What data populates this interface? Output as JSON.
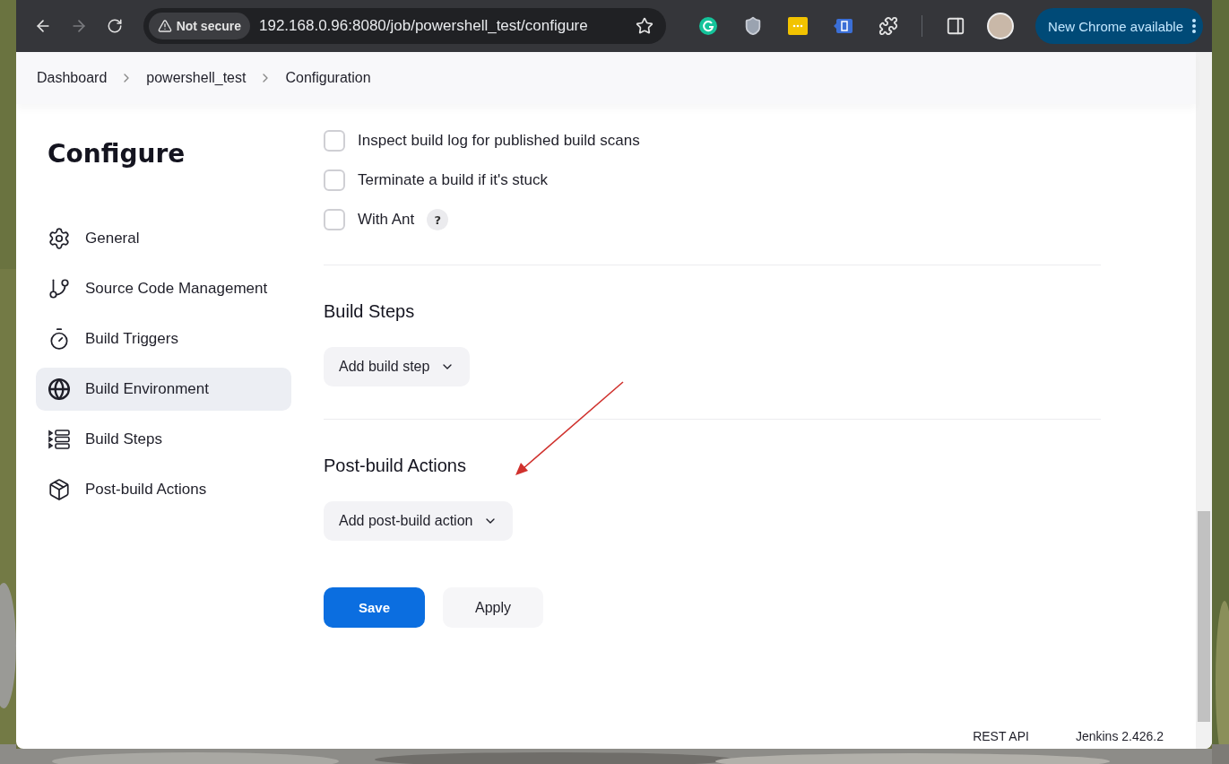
{
  "browser": {
    "not_secure_label": "Not secure",
    "url": "192.168.0.96:8080/job/powershell_test/configure",
    "update_button": "New Chrome available"
  },
  "breadcrumbs": [
    "Dashboard",
    "powershell_test",
    "Configuration"
  ],
  "sidebar": {
    "title": "Configure",
    "items": [
      {
        "label": "General",
        "kind": "gear",
        "selected": false
      },
      {
        "label": "Source Code Management",
        "kind": "branch",
        "selected": false
      },
      {
        "label": "Build Triggers",
        "kind": "timer",
        "selected": false
      },
      {
        "label": "Build Environment",
        "kind": "globe",
        "selected": true
      },
      {
        "label": "Build Steps",
        "kind": "steps",
        "selected": false
      },
      {
        "label": "Post-build Actions",
        "kind": "package",
        "selected": false
      }
    ]
  },
  "options": [
    {
      "label": "Inspect build log for published build scans",
      "checked": false
    },
    {
      "label": "Terminate a build if it's stuck",
      "checked": false
    },
    {
      "label": "With Ant",
      "checked": false,
      "help": "?"
    }
  ],
  "sections": [
    {
      "title": "Build Steps",
      "button": "Add build step",
      "annotated": false
    },
    {
      "title": "Post-build Actions",
      "button": "Add post-build action",
      "annotated": true
    }
  ],
  "actions": {
    "save": "Save",
    "apply": "Apply"
  },
  "footer": [
    "REST API",
    "Jenkins 2.426.2"
  ]
}
